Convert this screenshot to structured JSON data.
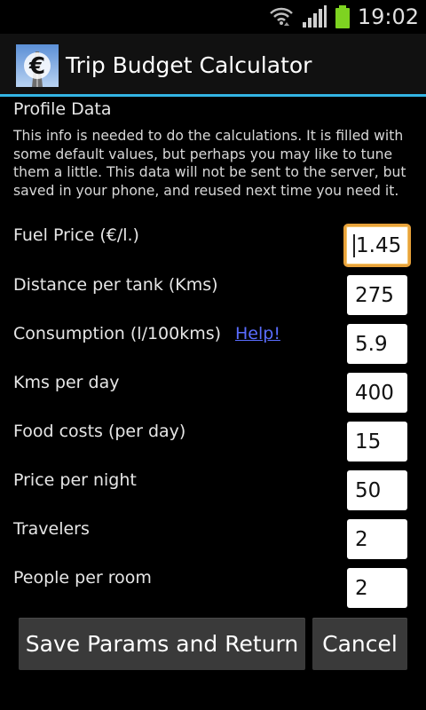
{
  "status_bar": {
    "time": "19:02",
    "icons": [
      "wifi-icon",
      "signal-icon",
      "battery-icon"
    ],
    "battery_color": "#7ed321"
  },
  "app": {
    "title": "Trip Budget Calculator",
    "icon": "euro-road-icon",
    "icon_glyph": "€",
    "accent_color": "#33b5e5"
  },
  "profile": {
    "section_title": "Profile Data",
    "info": "This info is needed to do the calculations. It is filled with some default values, but perhaps you may like to tune them a little. This data will not be sent to the server, but saved in your phone, and reused next time you need it."
  },
  "fields": [
    {
      "label": "Fuel Price (€/l.)",
      "value": "1.45"
    },
    {
      "label": "Distance per tank (Kms)",
      "value": "275"
    },
    {
      "label": "Consumption (l/100kms)",
      "value": "5.9",
      "link": "Help!"
    },
    {
      "label": "Kms per day",
      "value": "400"
    },
    {
      "label": "Food costs (per day)",
      "value": "15"
    },
    {
      "label": "Price per night",
      "value": "50"
    },
    {
      "label": "Travelers",
      "value": "2"
    },
    {
      "label": "People per room",
      "value": "2"
    }
  ],
  "buttons": {
    "save": "Save Params and Return",
    "cancel": "Cancel"
  }
}
